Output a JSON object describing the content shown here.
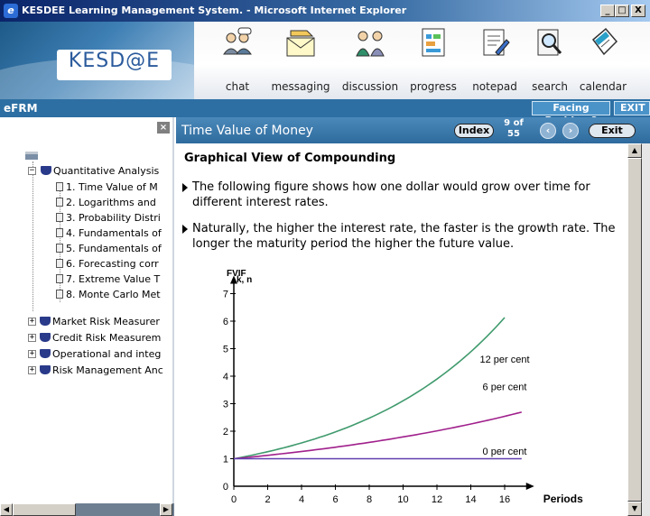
{
  "window": {
    "title": "KESDEE Learning Management System. - Microsoft Internet Explorer",
    "minimize": "_",
    "restore": "□",
    "close": "X"
  },
  "header": {
    "logo": "KESD@E",
    "nav": [
      {
        "label": "chat",
        "icon": "chat-icon"
      },
      {
        "label": "messaging",
        "icon": "messaging-icon"
      },
      {
        "label": "discussion",
        "icon": "discussion-icon"
      },
      {
        "label": "progress",
        "icon": "progress-icon"
      },
      {
        "label": "notepad",
        "icon": "notepad-icon"
      },
      {
        "label": "search",
        "icon": "search-icon"
      },
      {
        "label": "calendar",
        "icon": "calendar-icon"
      }
    ]
  },
  "bar": {
    "label": "eFRM",
    "facing_problem": "Facing Problem?",
    "exit": "EXIT"
  },
  "tree": {
    "close": "×",
    "root": "Quantitative Analysis",
    "chapters": [
      "1. Time Value of M",
      "2. Logarithms and",
      "3. Probability Distri",
      "4. Fundamentals of",
      "5. Fundamentals of",
      "6. Forecasting corr",
      "7. Extreme Value T",
      "8. Monte Carlo Met"
    ],
    "sections": [
      "Market Risk Measurer",
      "Credit Risk Measurem",
      "Operational and integ",
      "Risk Management Anc"
    ]
  },
  "topic": {
    "title": "Time Value of Money",
    "index_label": "Index",
    "page": "9 of",
    "total": "55",
    "exit_label": "Exit"
  },
  "content": {
    "heading": "Graphical View of Compounding",
    "bullets": [
      "The following figure shows how one dollar would grow over time for different interest rates.",
      "Naturally, the higher the interest rate, the faster is the growth rate. The longer the maturity period the higher the future value."
    ]
  },
  "chart_data": {
    "type": "line",
    "ylabel": "FVIF",
    "ylabel_sub": "k, n",
    "xlabel": "Periods",
    "xlim": [
      0,
      17
    ],
    "ylim": [
      0,
      7
    ],
    "xticks": [
      0,
      2,
      4,
      6,
      8,
      10,
      12,
      14,
      16
    ],
    "yticks": [
      1,
      2,
      3,
      4,
      5,
      6,
      7
    ],
    "series": [
      {
        "name": "12 per cent",
        "rate": 0.12,
        "x": [
          0,
          2,
          4,
          6,
          8,
          10,
          12,
          14,
          16
        ],
        "values": [
          1.0,
          1.25,
          1.57,
          1.97,
          2.48,
          3.11,
          3.9,
          4.89,
          6.13
        ],
        "color": "#3f9a6d"
      },
      {
        "name": "6 per cent",
        "rate": 0.06,
        "x": [
          0,
          2,
          4,
          6,
          8,
          10,
          12,
          14,
          16,
          17
        ],
        "values": [
          1.0,
          1.12,
          1.26,
          1.42,
          1.59,
          1.79,
          2.01,
          2.26,
          2.54,
          2.69
        ],
        "color": "#a0208c"
      },
      {
        "name": "0 per cent",
        "rate": 0.0,
        "x": [
          0,
          17
        ],
        "values": [
          1.0,
          1.0
        ],
        "color": "#6040b0"
      }
    ],
    "colors": {
      "axis": "#000000"
    }
  }
}
